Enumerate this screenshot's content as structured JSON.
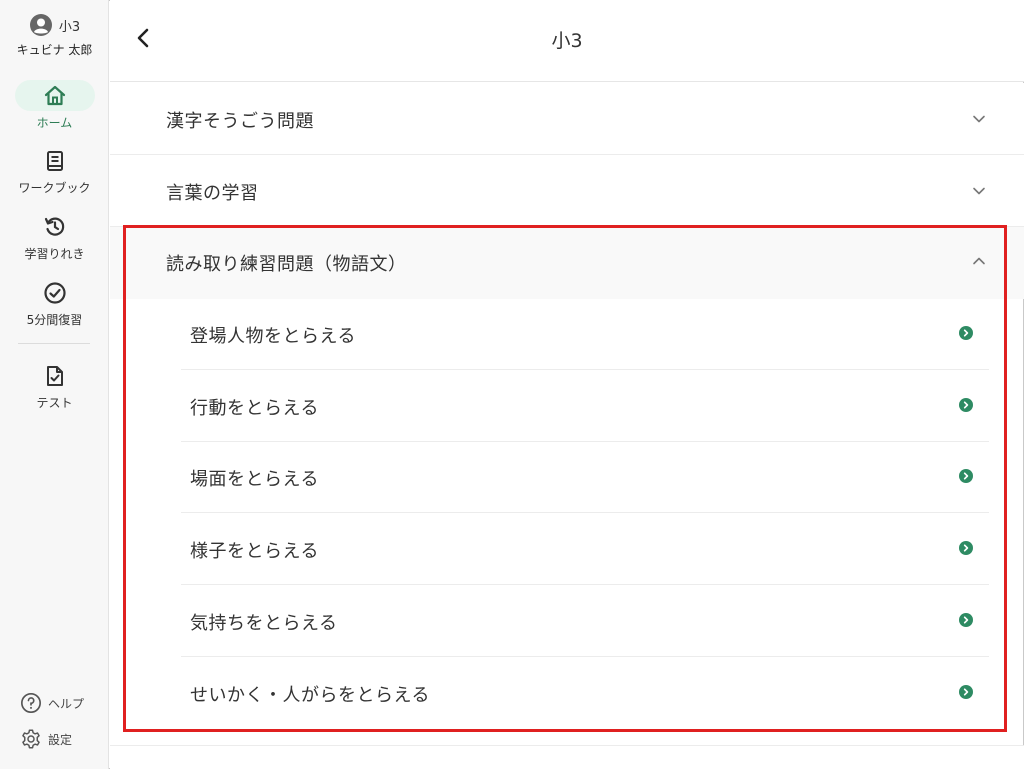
{
  "user": {
    "grade": "小3",
    "name": "キュビナ 太郎"
  },
  "nav": {
    "home": "ホーム",
    "workbook": "ワークブック",
    "history": "学習りれき",
    "review": "5分間復習",
    "test": "テスト"
  },
  "footer": {
    "help": "ヘルプ",
    "settings": "設定"
  },
  "header": {
    "title": "小3"
  },
  "sections": [
    {
      "title": "漢字そうごう問題",
      "expanded": false
    },
    {
      "title": "言葉の学習",
      "expanded": false
    },
    {
      "title": "読み取り練習問題（物語文）",
      "expanded": true,
      "items": [
        "登場人物をとらえる",
        "行動をとらえる",
        "場面をとらえる",
        "様子をとらえる",
        "気持ちをとらえる",
        "せいかく・人がらをとらえる"
      ]
    }
  ],
  "colors": {
    "accent": "#2e7d55",
    "go_icon": "#2e8b63",
    "highlight": "#e02020",
    "home_pill": "#e6f5ee"
  },
  "icons": {
    "avatar": "user-avatar-icon",
    "home": "home-icon",
    "workbook": "book-icon",
    "history": "history-icon",
    "review": "check-circle-icon",
    "test": "document-check-icon",
    "help": "help-icon",
    "settings": "gear-icon",
    "back": "chevron-left-icon",
    "collapsed": "chevron-down-icon",
    "expanded": "chevron-up-icon",
    "go": "arrow-right-circle-icon"
  }
}
